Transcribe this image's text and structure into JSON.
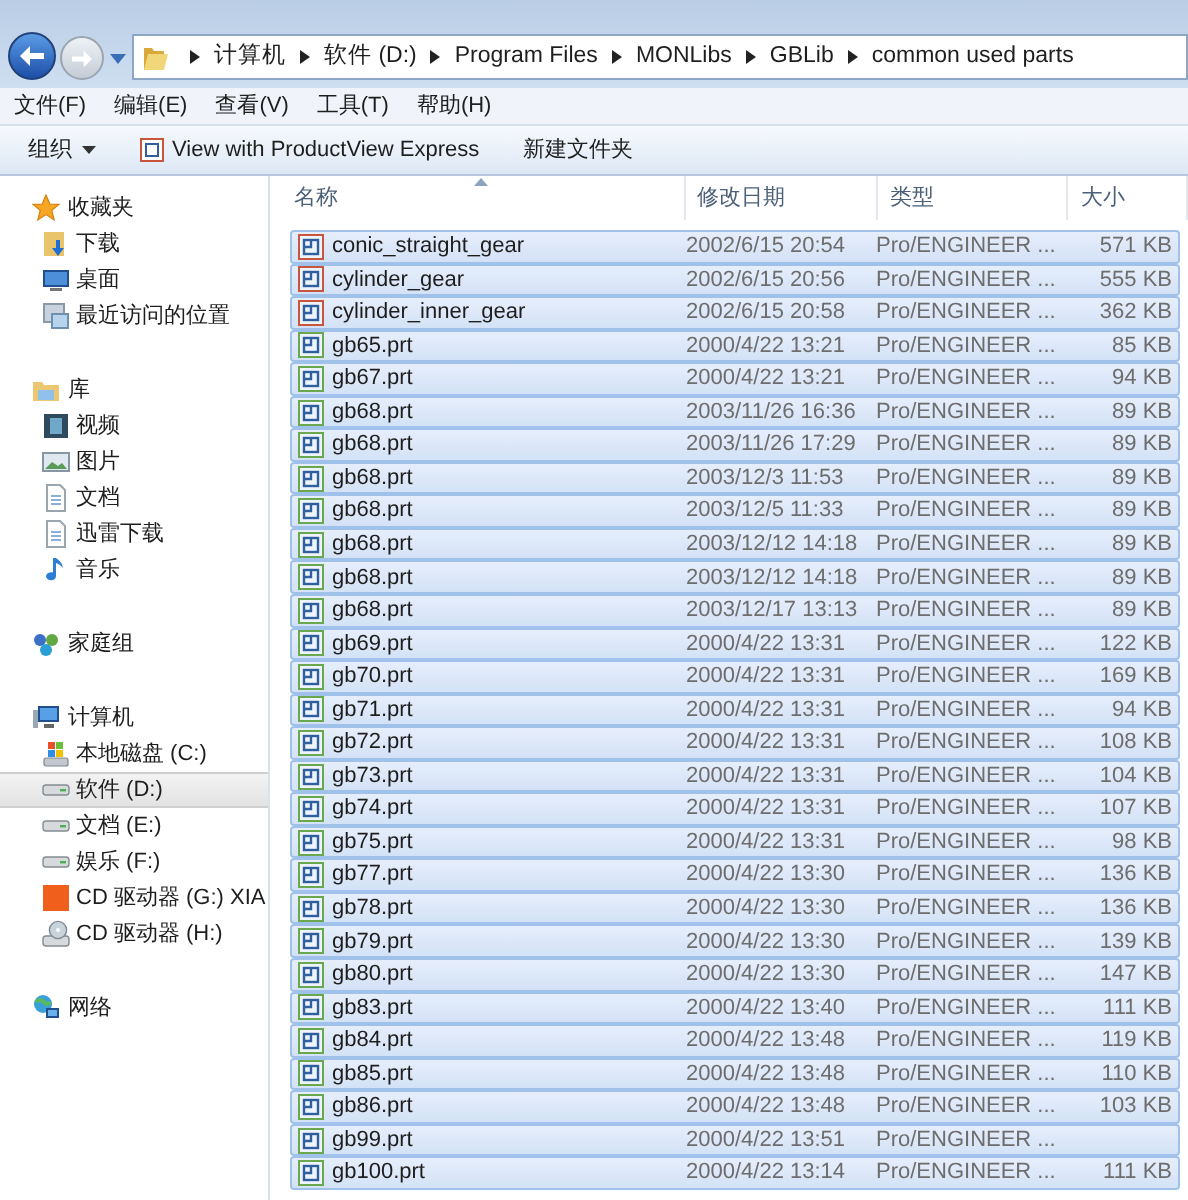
{
  "navigation": {
    "breadcrumb": [
      "计算机",
      "软件 (D:)",
      "Program Files",
      "MONLibs",
      "GBLib",
      "common used parts"
    ]
  },
  "menu": [
    "文件(F)",
    "编辑(E)",
    "查看(V)",
    "工具(T)",
    "帮助(H)"
  ],
  "toolbar": {
    "organize": "组织",
    "buttons": [
      {
        "kind": "productview",
        "label": "View with ProductView Express"
      },
      {
        "kind": "plain",
        "label": "新建文件夹"
      }
    ]
  },
  "sidebar": {
    "groups": [
      {
        "label": "收藏夹",
        "items": [
          {
            "label": "下载",
            "selected": false
          },
          {
            "label": "桌面",
            "selected": false
          },
          {
            "label": "最近访问的位置",
            "selected": false
          }
        ]
      },
      {
        "label": "库",
        "items": [
          {
            "label": "视频",
            "selected": false
          },
          {
            "label": "图片",
            "selected": false
          },
          {
            "label": "文档",
            "selected": false
          },
          {
            "label": "迅雷下载",
            "selected": false
          },
          {
            "label": "音乐",
            "selected": false
          }
        ]
      },
      {
        "label": "家庭组"
      },
      {
        "label": "计算机",
        "items": [
          {
            "label": "本地磁盘 (C:)",
            "selected": false
          },
          {
            "label": "软件 (D:)",
            "selected": true
          },
          {
            "label": "文档 (E:)",
            "selected": false
          },
          {
            "label": "娱乐 (F:)",
            "selected": false
          },
          {
            "label": "CD 驱动器 (G:) XIA",
            "selected": false
          },
          {
            "label": "CD 驱动器 (H:)",
            "selected": false
          }
        ]
      },
      {
        "label": "网络"
      }
    ]
  },
  "table": {
    "columns": [
      {
        "label": "名称",
        "sorted": true
      },
      {
        "label": "修改日期",
        "sorted": false
      },
      {
        "label": "类型",
        "sorted": false
      },
      {
        "label": "大小",
        "sorted": false
      }
    ],
    "rows": [
      {
        "kind": "assembly",
        "name": "conic_straight_gear",
        "modified": "2002/6/15 20:54",
        "type": "Pro/ENGINEER ...",
        "size": "571 KB",
        "selected": true
      },
      {
        "kind": "assembly",
        "name": "cylinder_gear",
        "modified": "2002/6/15 20:56",
        "type": "Pro/ENGINEER ...",
        "size": "555 KB",
        "selected": true
      },
      {
        "kind": "assembly",
        "name": "cylinder_inner_gear",
        "modified": "2002/6/15 20:58",
        "type": "Pro/ENGINEER ...",
        "size": "362 KB",
        "selected": true
      },
      {
        "kind": "part",
        "name": "gb65.prt",
        "modified": "2000/4/22 13:21",
        "type": "Pro/ENGINEER ...",
        "size": "85 KB",
        "selected": true
      },
      {
        "kind": "part",
        "name": "gb67.prt",
        "modified": "2000/4/22 13:21",
        "type": "Pro/ENGINEER ...",
        "size": "94 KB",
        "selected": true
      },
      {
        "kind": "part",
        "name": "gb68.prt",
        "modified": "2003/11/26 16:36",
        "type": "Pro/ENGINEER ...",
        "size": "89 KB",
        "selected": true
      },
      {
        "kind": "part",
        "name": "gb68.prt",
        "modified": "2003/11/26 17:29",
        "type": "Pro/ENGINEER ...",
        "size": "89 KB",
        "selected": true
      },
      {
        "kind": "part",
        "name": "gb68.prt",
        "modified": "2003/12/3 11:53",
        "type": "Pro/ENGINEER ...",
        "size": "89 KB",
        "selected": true
      },
      {
        "kind": "part",
        "name": "gb68.prt",
        "modified": "2003/12/5 11:33",
        "type": "Pro/ENGINEER ...",
        "size": "89 KB",
        "selected": true
      },
      {
        "kind": "part",
        "name": "gb68.prt",
        "modified": "2003/12/12 14:18",
        "type": "Pro/ENGINEER ...",
        "size": "89 KB",
        "selected": true
      },
      {
        "kind": "part",
        "name": "gb68.prt",
        "modified": "2003/12/12 14:18",
        "type": "Pro/ENGINEER ...",
        "size": "89 KB",
        "selected": true
      },
      {
        "kind": "part",
        "name": "gb68.prt",
        "modified": "2003/12/17 13:13",
        "type": "Pro/ENGINEER ...",
        "size": "89 KB",
        "selected": true
      },
      {
        "kind": "part",
        "name": "gb69.prt",
        "modified": "2000/4/22 13:31",
        "type": "Pro/ENGINEER ...",
        "size": "122 KB",
        "selected": true
      },
      {
        "kind": "part",
        "name": "gb70.prt",
        "modified": "2000/4/22 13:31",
        "type": "Pro/ENGINEER ...",
        "size": "169 KB",
        "selected": true
      },
      {
        "kind": "part",
        "name": "gb71.prt",
        "modified": "2000/4/22 13:31",
        "type": "Pro/ENGINEER ...",
        "size": "94 KB",
        "selected": true
      },
      {
        "kind": "part",
        "name": "gb72.prt",
        "modified": "2000/4/22 13:31",
        "type": "Pro/ENGINEER ...",
        "size": "108 KB",
        "selected": true
      },
      {
        "kind": "part",
        "name": "gb73.prt",
        "modified": "2000/4/22 13:31",
        "type": "Pro/ENGINEER ...",
        "size": "104 KB",
        "selected": true
      },
      {
        "kind": "part",
        "name": "gb74.prt",
        "modified": "2000/4/22 13:31",
        "type": "Pro/ENGINEER ...",
        "size": "107 KB",
        "selected": true
      },
      {
        "kind": "part",
        "name": "gb75.prt",
        "modified": "2000/4/22 13:31",
        "type": "Pro/ENGINEER ...",
        "size": "98 KB",
        "selected": true
      },
      {
        "kind": "part",
        "name": "gb77.prt",
        "modified": "2000/4/22 13:30",
        "type": "Pro/ENGINEER ...",
        "size": "136 KB",
        "selected": true
      },
      {
        "kind": "part",
        "name": "gb78.prt",
        "modified": "2000/4/22 13:30",
        "type": "Pro/ENGINEER ...",
        "size": "136 KB",
        "selected": true
      },
      {
        "kind": "part",
        "name": "gb79.prt",
        "modified": "2000/4/22 13:30",
        "type": "Pro/ENGINEER ...",
        "size": "139 KB",
        "selected": true
      },
      {
        "kind": "part",
        "name": "gb80.prt",
        "modified": "2000/4/22 13:30",
        "type": "Pro/ENGINEER ...",
        "size": "147 KB",
        "selected": true
      },
      {
        "kind": "part",
        "name": "gb83.prt",
        "modified": "2000/4/22 13:40",
        "type": "Pro/ENGINEER ...",
        "size": "111 KB",
        "selected": true
      },
      {
        "kind": "part",
        "name": "gb84.prt",
        "modified": "2000/4/22 13:48",
        "type": "Pro/ENGINEER ...",
        "size": "119 KB",
        "selected": true
      },
      {
        "kind": "part",
        "name": "gb85.prt",
        "modified": "2000/4/22 13:48",
        "type": "Pro/ENGINEER ...",
        "size": "110 KB",
        "selected": true
      },
      {
        "kind": "part",
        "name": "gb86.prt",
        "modified": "2000/4/22 13:48",
        "type": "Pro/ENGINEER ...",
        "size": "103 KB",
        "selected": true
      },
      {
        "kind": "part",
        "name": "gb99.prt",
        "modified": "2000/4/22 13:51",
        "type": "Pro/ENGINEER ...",
        "selected": true
      },
      {
        "kind": "part",
        "name": "gb100.prt",
        "modified": "2000/4/22 13:14",
        "type": "Pro/ENGINEER ...",
        "size": "111 KB",
        "selected": true
      }
    ]
  }
}
